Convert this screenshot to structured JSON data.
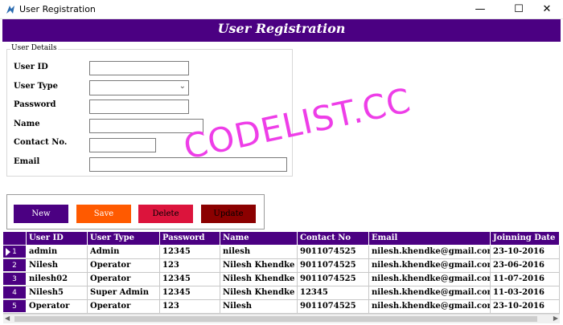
{
  "window": {
    "title": "User Registration",
    "minimize_glyph": "—",
    "maximize_glyph": "☐",
    "close_glyph": "✕"
  },
  "header": {
    "title": "User Registration"
  },
  "details": {
    "legend": "User Details",
    "labels": {
      "user_id": "User ID",
      "user_type": "User Type",
      "password": "Password",
      "name": "Name",
      "contact": "Contact No.",
      "email": "Email"
    },
    "values": {
      "user_id": "",
      "user_type": "",
      "password": "",
      "name": "",
      "contact": "",
      "email": ""
    }
  },
  "buttons": {
    "new": "New",
    "save": "Save",
    "delete": "Delete",
    "update": "Update"
  },
  "watermark": "CODELIST.CC",
  "grid": {
    "columns": [
      "User ID",
      "User Type",
      "Password",
      "Name",
      "Contact No",
      "Email",
      "Joinning Date"
    ],
    "rows": [
      {
        "num": "1",
        "user_id": "admin",
        "user_type": "Admin",
        "password": "12345",
        "name": "nilesh",
        "contact": "9011074525",
        "email": "nilesh.khendke@gmail.com",
        "date": "23-10-2016"
      },
      {
        "num": "2",
        "user_id": "Nilesh",
        "user_type": "Operator",
        "password": "123",
        "name": "Nilesh Khendke",
        "contact": "9011074525",
        "email": "nilesh.khendke@gmail.com",
        "date": "23-06-2016"
      },
      {
        "num": "3",
        "user_id": "nilesh02",
        "user_type": "Operator",
        "password": "12345",
        "name": "Nilesh Khendke",
        "contact": "9011074525",
        "email": "nilesh.khendke@gmail.com",
        "date": "11-07-2016"
      },
      {
        "num": "4",
        "user_id": "Nilesh5",
        "user_type": "Super Admin",
        "password": "12345",
        "name": "Nilesh Khendke",
        "contact": "12345",
        "email": "nilesh.khendke@gmail.com",
        "date": "11-03-2016"
      },
      {
        "num": "5",
        "user_id": "Operator",
        "user_type": "Operator",
        "password": "123",
        "name": "Nilesh",
        "contact": "9011074525",
        "email": "nilesh.khendke@gmail.com",
        "date": "23-10-2016"
      }
    ]
  },
  "scroll": {
    "left_glyph": "◀",
    "right_glyph": "▶"
  },
  "colors": {
    "header_bg": "#4b0082",
    "new_button": "#4b0082",
    "save_button": "#ff5a00",
    "delete_button": "#dc143c",
    "update_button": "#8b0000",
    "watermark": "#ee3ee8"
  },
  "icons": {
    "app": "app-logo-icon",
    "combo": "chevron-down-icon",
    "current_row": "row-pointer-icon"
  }
}
